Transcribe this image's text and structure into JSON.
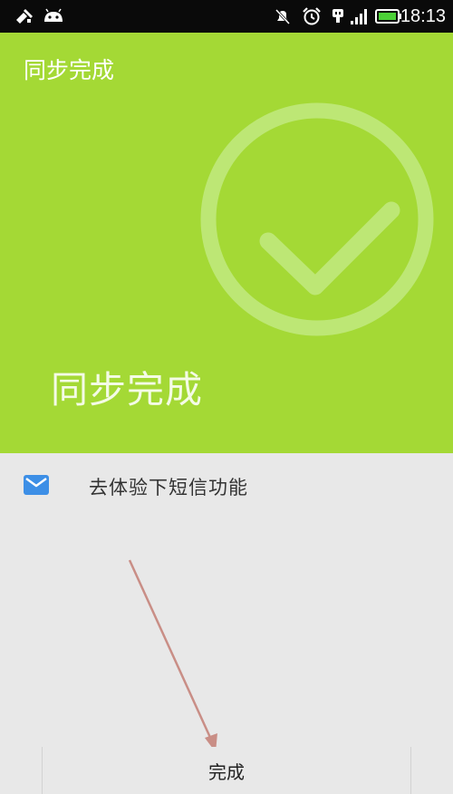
{
  "status_bar": {
    "time": "18:13",
    "icons": [
      "signal-wave-icon",
      "android-icon",
      "silent-bell-icon",
      "alarm-icon",
      "usb-icon",
      "cell-signal-icon",
      "battery-icon"
    ],
    "battery_color": "#4cd137"
  },
  "hero": {
    "top_title": "同步完成",
    "big_title": "同步完成",
    "background": "#a4d935",
    "icon": "checkmark-circle-icon"
  },
  "list": {
    "items": [
      {
        "icon": "mail-icon",
        "label": "去体验下短信功能"
      }
    ]
  },
  "footer": {
    "done_label": "完成"
  }
}
